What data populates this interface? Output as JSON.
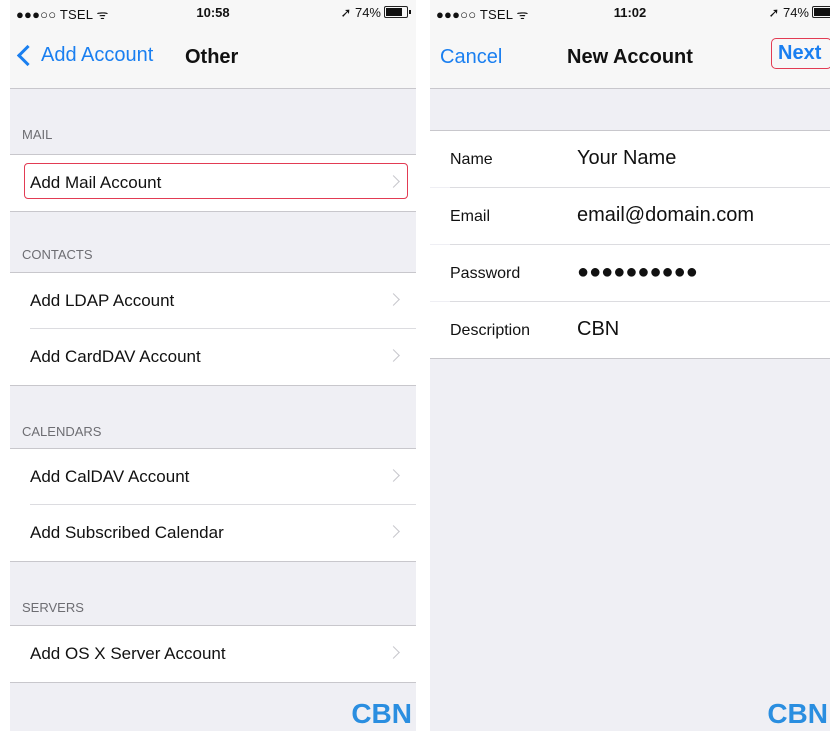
{
  "left": {
    "status": {
      "carrier": "●●●○○ TSEL ᯤ",
      "time": "10:58",
      "battery": "➚ 74%"
    },
    "nav": {
      "back_label": "Add Account",
      "title": "Other"
    },
    "sections": [
      {
        "header": "MAIL",
        "items": [
          "Add Mail Account"
        ]
      },
      {
        "header": "CONTACTS",
        "items": [
          "Add LDAP Account",
          "Add CardDAV Account"
        ]
      },
      {
        "header": "CALENDARS",
        "items": [
          "Add CalDAV Account",
          "Add Subscribed Calendar"
        ]
      },
      {
        "header": "SERVERS",
        "items": [
          "Add OS X Server Account"
        ]
      }
    ],
    "watermark": "CBN"
  },
  "right": {
    "status": {
      "carrier": "●●●○○ TSEL ᯤ",
      "time": "11:02",
      "battery": "➚ 74%"
    },
    "nav": {
      "cancel_label": "Cancel",
      "title": "New Account",
      "next_label": "Next"
    },
    "form": [
      {
        "label": "Name",
        "value": "Your Name"
      },
      {
        "label": "Email",
        "value": "email@domain.com"
      },
      {
        "label": "Password",
        "value": "●●●●●●●●●●"
      },
      {
        "label": "Description",
        "value": "CBN"
      }
    ],
    "watermark": "CBN"
  },
  "colors": {
    "accent": "#1a7ff0",
    "highlight": "#e23b53",
    "group_bg": "#efeff4"
  },
  "icons": [
    "chevron-left-icon",
    "chevron-right-icon",
    "wifi-icon",
    "location-icon",
    "battery-icon"
  ]
}
